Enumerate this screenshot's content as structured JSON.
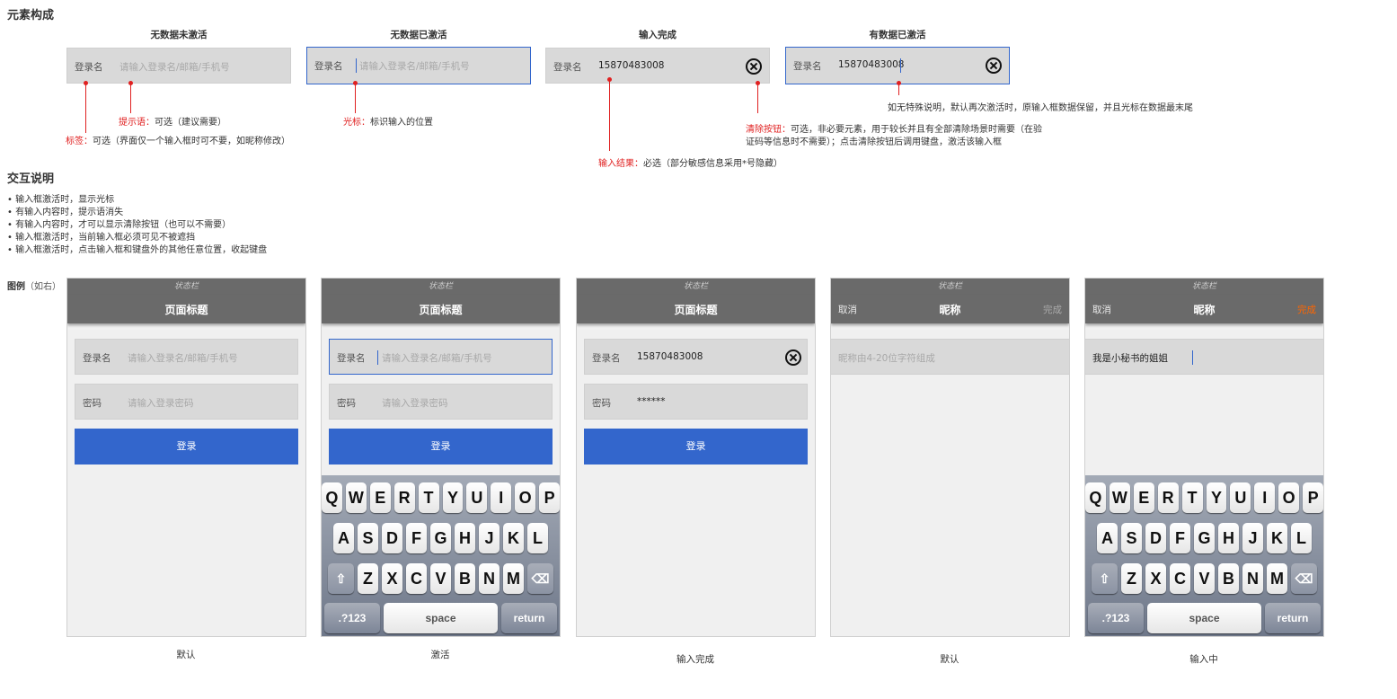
{
  "sections": {
    "composition": "元素构成",
    "interaction": "交互说明",
    "example": "图例",
    "example_sub": "（如右）"
  },
  "states": {
    "s1": {
      "title": "无数据未激活",
      "label": "登录名",
      "placeholder": "请输入登录名/邮箱/手机号"
    },
    "s2": {
      "title": "无数据已激活",
      "label": "登录名",
      "placeholder": "请输入登录名/邮箱/手机号"
    },
    "s3": {
      "title": "输入完成",
      "label": "登录名",
      "value": "15870483008"
    },
    "s4": {
      "title": "有数据已激活",
      "label": "登录名",
      "value": "15870483008"
    }
  },
  "annotations": {
    "hint_key": "提示语：",
    "hint_text": "可选（建议需要）",
    "label_key": "标签：",
    "label_text": "可选（界面仅一个输入框时可不要，如昵称修改）",
    "cursor_key": "光标：",
    "cursor_text": "标识输入的位置",
    "result_key": "输入结果：",
    "result_text": "必选（部分敏感信息采用*号隐藏）",
    "clear_key": "清除按钮：",
    "clear_text1": "可选，非必要元素，用于较长并且有全部清除场景时需要（在验",
    "clear_text2": "证码等信息时不需要）；点击清除按钮后调用键盘，激活该输入框",
    "active_text": "如无特殊说明，默认再次激活时，原输入框数据保留，并且光标在数据最末尾"
  },
  "bullets": [
    "• 输入框激活时，显示光标",
    "• 有输入内容时，提示语消失",
    "• 有输入内容时，才可以显示清除按钮（也可以不需要）",
    "• 输入框激活时，当前输入框必须可见不被遮挡",
    "• 输入框激活时，点击输入框和键盘外的其他任意位置，收起键盘"
  ],
  "phones": {
    "statusbar": "状态栏",
    "page_title": "页面标题",
    "login_label": "登录名",
    "login_placeholder": "请输入登录名/邮箱/手机号",
    "pwd_label": "密码",
    "pwd_placeholder": "请输入登录密码",
    "login_value": "15870483008",
    "pwd_value": "******",
    "login_button": "登录",
    "nick_title": "昵称",
    "cancel": "取消",
    "done": "完成",
    "nick_placeholder": "昵称由4-20位字符组成",
    "nick_value": "我是小秘书的姐姐",
    "captions": [
      "默认",
      "激活",
      "输入完成",
      "默认",
      "输入中"
    ]
  },
  "keyboard": {
    "row1": [
      "Q",
      "W",
      "E",
      "R",
      "T",
      "Y",
      "U",
      "I",
      "O",
      "P"
    ],
    "row2": [
      "A",
      "S",
      "D",
      "F",
      "G",
      "H",
      "J",
      "K",
      "L"
    ],
    "row3": [
      "Z",
      "X",
      "C",
      "V",
      "B",
      "N",
      "M"
    ],
    "shift": "⇧",
    "backspace": "⌫",
    "mode": ".?123",
    "space": "space",
    "return": "return"
  },
  "colors": {
    "accent_blue": "#3366cc",
    "annotation_red": "#e02020",
    "nav_gray": "#6a6a6a",
    "done_orange": "#ff6600"
  }
}
